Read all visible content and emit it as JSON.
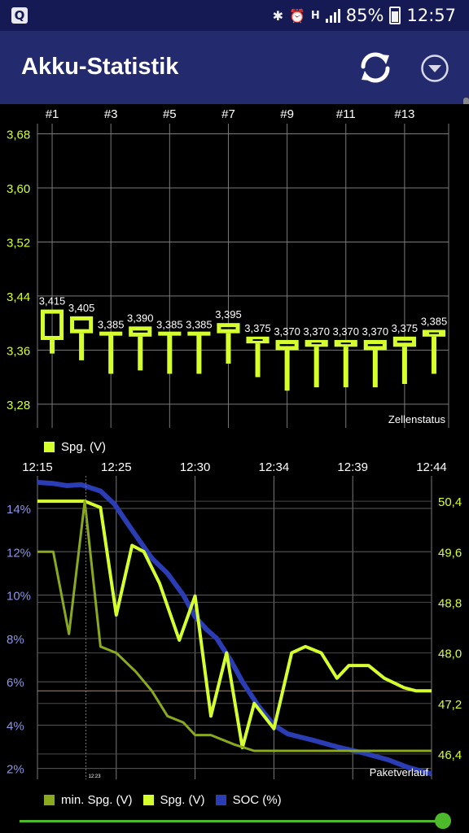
{
  "status_bar": {
    "badge": "Q",
    "battery": "85%",
    "time": "12:57",
    "network": "H",
    "icons": [
      "bluetooth-icon",
      "alarm-icon",
      "network-type-icon",
      "signal-icon",
      "battery-icon"
    ]
  },
  "app_bar": {
    "title": "Akku-Statistik",
    "actions": [
      "refresh-icon",
      "dropdown-menu-icon"
    ]
  },
  "colors": {
    "status_bar": "#151a54",
    "app_bar": "#232b6e",
    "lime": "#d6ff2e",
    "olive": "#8aa91f",
    "blue": "#2b3db4",
    "grid": "#7a7a7a",
    "slider": "#4cba2a"
  },
  "chart_data": [
    {
      "type": "box",
      "name": "Zellenstatus",
      "x_labels": [
        "#1",
        "#3",
        "#5",
        "#7",
        "#9",
        "#11",
        "#13"
      ],
      "y_ticks": [
        "3,68",
        "3,60",
        "3,52",
        "3,44",
        "3,36",
        "3,28"
      ],
      "ylim": [
        3.245,
        3.695
      ],
      "footer": "Zellenstatus",
      "legend": [
        "Spg. (V)"
      ],
      "cells": [
        {
          "label": "3,415",
          "box": [
            3.375,
            3.42
          ],
          "whisker": [
            3.355,
            3.42
          ]
        },
        {
          "label": "3,405",
          "box": [
            3.385,
            3.41
          ],
          "whisker": [
            3.345,
            3.41
          ]
        },
        {
          "label": "3,385",
          "box": [
            3.385,
            3.385
          ],
          "whisker": [
            3.325,
            3.385
          ]
        },
        {
          "label": "3,390",
          "box": [
            3.38,
            3.395
          ],
          "whisker": [
            3.33,
            3.395
          ]
        },
        {
          "label": "3,385",
          "box": [
            3.385,
            3.385
          ],
          "whisker": [
            3.325,
            3.385
          ]
        },
        {
          "label": "3,385",
          "box": [
            3.385,
            3.385
          ],
          "whisker": [
            3.325,
            3.385
          ]
        },
        {
          "label": "3,395",
          "box": [
            3.385,
            3.4
          ],
          "whisker": [
            3.34,
            3.4
          ]
        },
        {
          "label": "3,375",
          "box": [
            3.37,
            3.38
          ],
          "whisker": [
            3.32,
            3.38
          ]
        },
        {
          "label": "3,370",
          "box": [
            3.36,
            3.375
          ],
          "whisker": [
            3.3,
            3.375
          ]
        },
        {
          "label": "3,370",
          "box": [
            3.365,
            3.375
          ],
          "whisker": [
            3.305,
            3.375
          ]
        },
        {
          "label": "3,370",
          "box": [
            3.365,
            3.375
          ],
          "whisker": [
            3.305,
            3.375
          ]
        },
        {
          "label": "3,370",
          "box": [
            3.36,
            3.375
          ],
          "whisker": [
            3.305,
            3.375
          ]
        },
        {
          "label": "3,375",
          "box": [
            3.365,
            3.38
          ],
          "whisker": [
            3.31,
            3.38
          ]
        },
        {
          "label": "3,385",
          "box": [
            3.38,
            3.39
          ],
          "whisker": [
            3.325,
            3.39
          ]
        }
      ]
    },
    {
      "type": "line",
      "name": "Paketverlauf",
      "x_ticks": [
        "12:15",
        "12:25",
        "12:30",
        "12:34",
        "12:39",
        "12:44"
      ],
      "left_ticks": [
        "14%",
        "12%",
        "10%",
        "8%",
        "6%",
        "4%",
        "2%"
      ],
      "right_ticks": [
        "50,4",
        "49,6",
        "48,8",
        "48,0",
        "47,2",
        "46,4"
      ],
      "left_lim": [
        1.5,
        15.5
      ],
      "right_lim": [
        46.0,
        50.8
      ],
      "footer": "Paketverlauf",
      "cursor_label": "12:23",
      "cursor_t": 0.123,
      "reference_line_right": 47.4,
      "legend": [
        "min. Spg. (V)",
        "Spg. (V)",
        "SOC (%)"
      ],
      "series": [
        {
          "name": "SOC (%)",
          "axis": "left",
          "points": [
            [
              0.0,
              15.2
            ],
            [
              0.04,
              15.15
            ],
            [
              0.075,
              15.05
            ],
            [
              0.11,
              15.1
            ],
            [
              0.16,
              14.8
            ],
            [
              0.195,
              14.2
            ],
            [
              0.24,
              13.0
            ],
            [
              0.29,
              11.7
            ],
            [
              0.33,
              11.0
            ],
            [
              0.37,
              10.0
            ],
            [
              0.4,
              9.0
            ],
            [
              0.43,
              8.4
            ],
            [
              0.455,
              8.0
            ],
            [
              0.49,
              7.0
            ],
            [
              0.52,
              6.0
            ],
            [
              0.56,
              4.9
            ],
            [
              0.6,
              4.0
            ],
            [
              0.635,
              3.6
            ],
            [
              0.7,
              3.3
            ],
            [
              0.76,
              3.0
            ],
            [
              0.83,
              2.7
            ],
            [
              0.89,
              2.4
            ],
            [
              0.94,
              2.05
            ],
            [
              0.98,
              1.85
            ],
            [
              1.0,
              1.75
            ]
          ]
        },
        {
          "name": "Spg. (V)",
          "axis": "right",
          "points": [
            [
              0.0,
              50.4
            ],
            [
              0.12,
              50.4
            ],
            [
              0.16,
              50.3
            ],
            [
              0.2,
              48.6
            ],
            [
              0.24,
              49.7
            ],
            [
              0.27,
              49.6
            ],
            [
              0.31,
              49.1
            ],
            [
              0.36,
              48.2
            ],
            [
              0.4,
              48.9
            ],
            [
              0.44,
              47.0
            ],
            [
              0.48,
              48.0
            ],
            [
              0.52,
              46.5
            ],
            [
              0.55,
              47.2
            ],
            [
              0.6,
              46.8
            ],
            [
              0.645,
              48.0
            ],
            [
              0.68,
              48.1
            ],
            [
              0.72,
              48.0
            ],
            [
              0.76,
              47.6
            ],
            [
              0.79,
              47.8
            ],
            [
              0.84,
              47.8
            ],
            [
              0.88,
              47.6
            ],
            [
              0.93,
              47.45
            ],
            [
              0.96,
              47.4
            ],
            [
              1.0,
              47.4
            ]
          ]
        },
        {
          "name": "min. Spg. (V)",
          "axis": "right",
          "points": [
            [
              0.0,
              49.6
            ],
            [
              0.04,
              49.6
            ],
            [
              0.08,
              48.3
            ],
            [
              0.12,
              50.4
            ],
            [
              0.16,
              48.1
            ],
            [
              0.2,
              48.0
            ],
            [
              0.25,
              47.7
            ],
            [
              0.29,
              47.4
            ],
            [
              0.33,
              47.0
            ],
            [
              0.37,
              46.9
            ],
            [
              0.4,
              46.7
            ],
            [
              0.44,
              46.7
            ],
            [
              0.5,
              46.55
            ],
            [
              0.55,
              46.45
            ],
            [
              0.62,
              46.45
            ],
            [
              0.7,
              46.45
            ],
            [
              0.8,
              46.45
            ],
            [
              0.9,
              46.45
            ],
            [
              1.0,
              46.45
            ]
          ]
        }
      ]
    }
  ]
}
